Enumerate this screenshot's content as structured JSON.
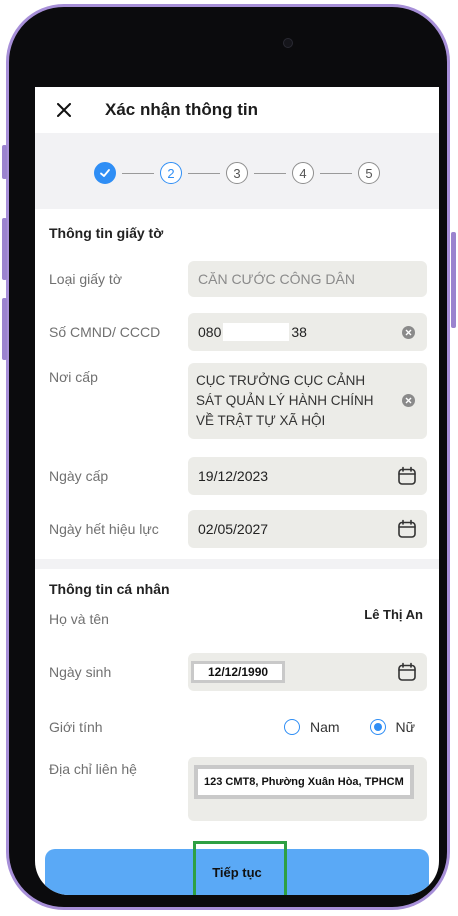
{
  "header": {
    "title": "Xác nhận thông tin"
  },
  "stepper": {
    "steps": [
      "",
      "2",
      "3",
      "4",
      "5"
    ],
    "current": 2
  },
  "document_section": {
    "title": "Thông tin giấy tờ",
    "fields": [
      {
        "label": "Loại giấy tờ",
        "value": "CĂN CƯỚC CÔNG DÂN"
      },
      {
        "label": "Số CMND/ CCCD",
        "value_prefix": "080",
        "value_suffix": "38"
      },
      {
        "label": "Nơi cấp",
        "value": "CỤC TRƯỞNG CỤC CẢNH SÁT QUẢN LÝ HÀNH CHÍNH VỀ TRẬT TỰ XÃ HỘI"
      },
      {
        "label": "Ngày cấp",
        "value": "19/12/2023"
      },
      {
        "label": "Ngày hết hiệu lực",
        "value": "02/05/2027"
      }
    ]
  },
  "personal_section": {
    "title": "Thông tin cá nhân",
    "fields": [
      {
        "label": "Họ và tên",
        "value": "Lê Thị An"
      },
      {
        "label": "Ngày sinh",
        "value": "12/12/1990"
      },
      {
        "label": "Giới tính",
        "options": [
          "Nam",
          "Nữ"
        ],
        "selected": "Nữ"
      },
      {
        "label": "Địa chỉ liên hệ",
        "value": "123 CMT8, Phường Xuân Hòa, TPHCM"
      }
    ]
  },
  "footer": {
    "continue_label": "Tiếp tục"
  },
  "colors": {
    "accent": "#2f8ef5",
    "button": "#5aa9f6",
    "frame": "#a78fd8",
    "highlight": "#2ea043"
  }
}
